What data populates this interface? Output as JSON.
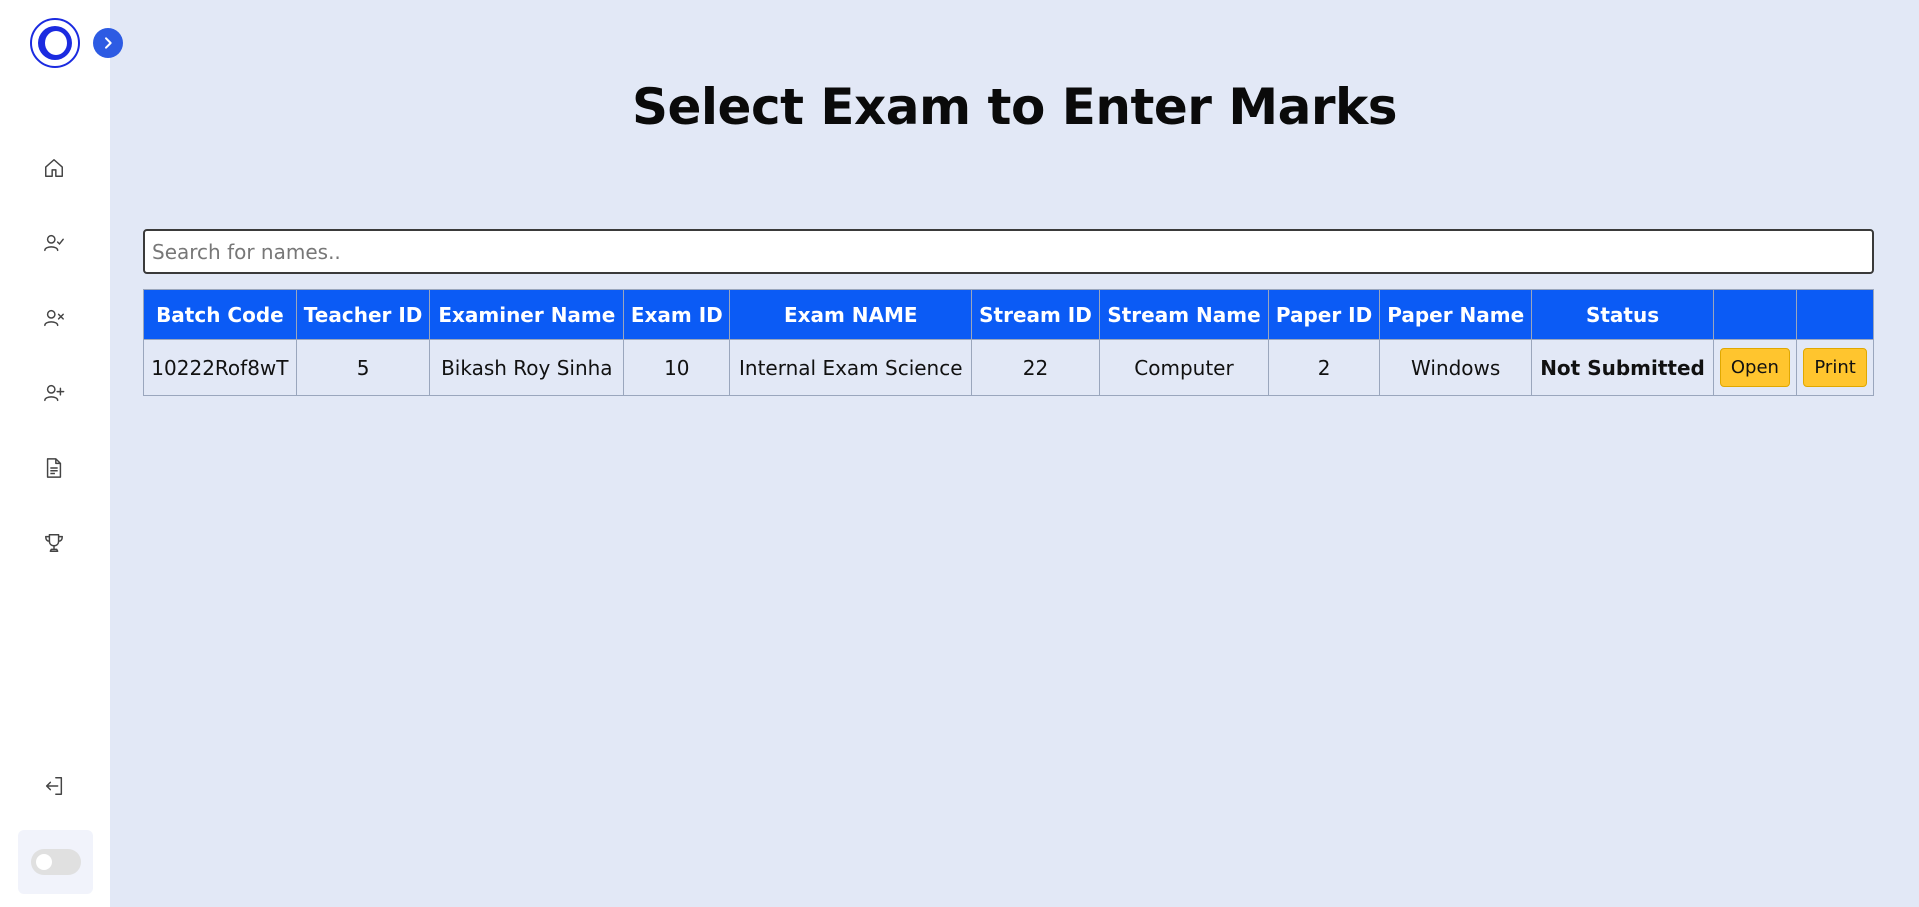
{
  "page": {
    "title": "Select Exam to Enter Marks"
  },
  "search": {
    "placeholder": "Search for names..",
    "value": ""
  },
  "sidebar": {
    "icons": [
      "home-icon",
      "user-check-icon",
      "user-x-icon",
      "user-plus-icon",
      "document-icon",
      "trophy-icon",
      "logout-icon"
    ]
  },
  "table": {
    "headers": [
      "Batch Code",
      "Teacher ID",
      "Examiner Name",
      "Exam ID",
      "Exam NAME",
      "Stream ID",
      "Stream Name",
      "Paper ID",
      "Paper Name",
      "Status",
      "",
      ""
    ],
    "rows": [
      {
        "batch_code": "10222Rof8wT",
        "teacher_id": "5",
        "examiner_name": "Bikash Roy Sinha",
        "exam_id": "10",
        "exam_name": "Internal Exam Science",
        "stream_id": "22",
        "stream_name": "Computer",
        "paper_id": "2",
        "paper_name": "Windows",
        "status": "Not Submitted",
        "open_label": "Open",
        "print_label": "Print"
      }
    ]
  },
  "colors": {
    "accent": "#0b5bf5",
    "status_not_submitted": "#e8000b",
    "action_button": "#ffc52e",
    "background": "#e2e8f6"
  }
}
